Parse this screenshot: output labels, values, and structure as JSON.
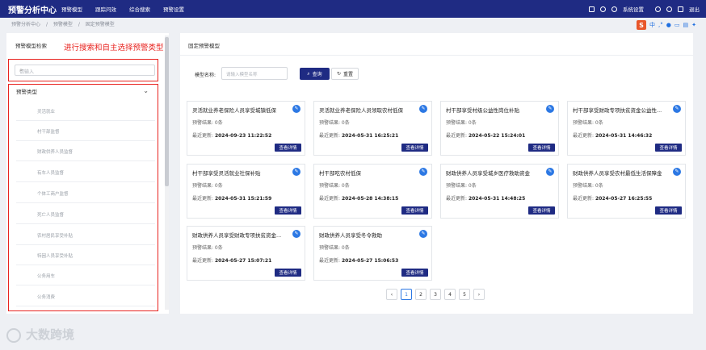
{
  "app": {
    "title": "预警分析中心"
  },
  "nav": {
    "items": [
      "预警模型",
      "跟踪问效",
      "综合搜索",
      "预警设置"
    ]
  },
  "topright": {
    "settings_label": "系统设置",
    "logout_label": "退出"
  },
  "breadcrumb": [
    "预警分析中心",
    "/",
    "预警模型",
    "/",
    "固定预警模型"
  ],
  "toolbar_icons": {
    "s_label": "S",
    "zh_label": "中"
  },
  "left_panel": {
    "title": "预警模型检索",
    "annotation": "进行搜索和自主选择预警类型",
    "search": {
      "placeholder": "请输入"
    },
    "tree_header": "预警类型",
    "items": [
      "灵活就业",
      "村干部监督",
      "财政供养人员监督",
      "有车人员监督",
      "个体工商户监督",
      "死亡人员监督",
      "农村居民享受补贴",
      "特困人员享受补贴",
      "公务用车",
      "公务消费"
    ]
  },
  "main": {
    "title": "固定预警模型",
    "filter": {
      "label": "模型名称:",
      "placeholder": "请输入模型名称",
      "query_label": "查询",
      "reset_label": "重置"
    },
    "cards": [
      {
        "title": "灵活就业养老保险人员享受城镇低保",
        "result": "预警结果: 0条",
        "updated_label": "最近更新:",
        "updated": "2024-09-23 11:22:52",
        "detail": "查看详情"
      },
      {
        "title": "灵活就业养老保险人员领取农村低保",
        "result": "预警结果: 0条",
        "updated_label": "最近更新:",
        "updated": "2024-05-31 16:25:21",
        "detail": "查看详情"
      },
      {
        "title": "村干部享受村级公益性岗位补贴",
        "result": "预警结果: 0条",
        "updated_label": "最近更新:",
        "updated": "2024-05-22 15:24:01",
        "detail": "查看详情"
      },
      {
        "title": "村干部享受财政专项扶贫资金公益性...",
        "result": "预警结果: 0条",
        "updated_label": "最近更新:",
        "updated": "2024-05-31 14:46:32",
        "detail": "查看详情"
      },
      {
        "title": "村干部享受灵活就业社保补贴",
        "result": "预警结果: 0条",
        "updated_label": "最近更新:",
        "updated": "2024-05-31 15:21:59",
        "detail": "查看详情"
      },
      {
        "title": "村干部吃农村低保",
        "result": "预警结果: 0条",
        "updated_label": "最近更新:",
        "updated": "2024-05-28 14:38:15",
        "detail": "查看详情"
      },
      {
        "title": "财政供养人员享受城乡医疗救助资金",
        "result": "预警结果: 0条",
        "updated_label": "最近更新:",
        "updated": "2024-05-31 14:48:25",
        "detail": "查看详情"
      },
      {
        "title": "财政供养人员享受农村最低生活保障金",
        "result": "预警结果: 0条",
        "updated_label": "最近更新:",
        "updated": "2024-05-27 16:25:55",
        "detail": "查看详情"
      },
      {
        "title": "财政供养人员享受财政专项扶贫资金...",
        "result": "预警结果: 0条",
        "updated_label": "最近更新:",
        "updated": "2024-05-27 15:07:21",
        "detail": "查看详情"
      },
      {
        "title": "财政供养人员享受冬令救助",
        "result": "预警结果: 0条",
        "updated_label": "最近更新:",
        "updated": "2024-05-27 15:06:53",
        "detail": "查看详情"
      }
    ],
    "pager": {
      "prev": "‹",
      "pages": [
        "1",
        "2",
        "3",
        "4",
        "5"
      ],
      "next": "›",
      "current": "1"
    }
  },
  "watermark": "大数跨境"
}
